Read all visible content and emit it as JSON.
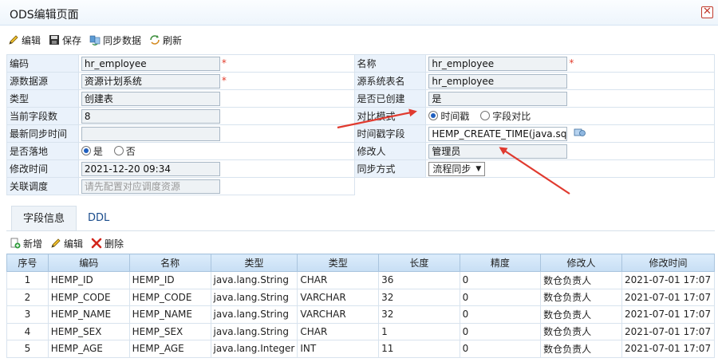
{
  "window": {
    "title": "ODS编辑页面",
    "close_glyph": "✕"
  },
  "toolbar": {
    "edit": "编辑",
    "save": "保存",
    "sync": "同步数据",
    "refresh": "刷新"
  },
  "form": {
    "code_label": "编码",
    "code_value": "hr_employee",
    "name_label": "名称",
    "name_value": "hr_employee",
    "source_label": "源数据源",
    "source_value": "资源计划系统",
    "src_table_label": "源系统表名",
    "src_table_value": "hr_employee",
    "type_label": "类型",
    "type_value": "创建表",
    "created_label": "是否已创建",
    "created_value": "是",
    "field_count_label": "当前字段数",
    "field_count_value": "8",
    "compare_label": "对比模式",
    "compare_opt1": "时间戳",
    "compare_opt2": "字段对比",
    "last_sync_label": "最新同步时间",
    "last_sync_value": "",
    "ts_field_label": "时间戳字段",
    "ts_field_value": "HEMP_CREATE_TIME(java.sql.T",
    "landing_label": "是否落地",
    "landing_yes": "是",
    "landing_no": "否",
    "modifier_label": "修改人",
    "modifier_value": "管理员",
    "mtime_label": "修改时间",
    "mtime_value": "2021-12-20 09:34",
    "sync_mode_label": "同步方式",
    "sync_mode_value": "流程同步",
    "schedule_label": "关联调度",
    "schedule_placeholder": "请先配置对应调度资源",
    "required_mark": "*"
  },
  "tabs": {
    "fields": "字段信息",
    "ddl": "DDL"
  },
  "subtoolbar": {
    "add": "新增",
    "edit": "编辑",
    "delete": "删除"
  },
  "table": {
    "headers": [
      "序号",
      "编码",
      "名称",
      "类型",
      "类型",
      "长度",
      "精度",
      "修改人",
      "修改时间"
    ],
    "rows": [
      [
        "1",
        "HEMP_ID",
        "HEMP_ID",
        "java.lang.String",
        "CHAR",
        "36",
        "0",
        "数仓负责人",
        "2021-07-01 17:07"
      ],
      [
        "2",
        "HEMP_CODE",
        "HEMP_CODE",
        "java.lang.String",
        "VARCHAR",
        "32",
        "0",
        "数仓负责人",
        "2021-07-01 17:07"
      ],
      [
        "3",
        "HEMP_NAME",
        "HEMP_NAME",
        "java.lang.String",
        "VARCHAR",
        "32",
        "0",
        "数仓负责人",
        "2021-07-01 17:07"
      ],
      [
        "4",
        "HEMP_SEX",
        "HEMP_SEX",
        "java.lang.String",
        "CHAR",
        "1",
        "0",
        "数仓负责人",
        "2021-07-01 17:07"
      ],
      [
        "5",
        "HEMP_AGE",
        "HEMP_AGE",
        "java.lang.Integer",
        "INT",
        "11",
        "0",
        "数仓负责人",
        "2021-07-01 17:07"
      ]
    ]
  },
  "colors": {
    "accent": "#1f5fbf",
    "annotation_arrow": "#e03a2f",
    "label_bg": "#eaf2fb",
    "header_bg": "#c7def4"
  },
  "icons": {
    "edit": "pencil-icon",
    "save": "floppy-icon",
    "sync": "sync-icon",
    "refresh": "refresh-icon",
    "add": "add-doc-icon",
    "delete": "delete-x-icon",
    "picker": "field-picker-icon"
  }
}
